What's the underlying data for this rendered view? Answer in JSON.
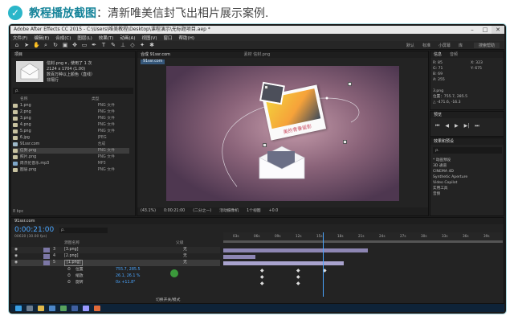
{
  "header": {
    "title": "教程播放截图",
    "subtitle": "：清新唯美信封飞出相片展示案例.",
    "check_icon": "check-icon"
  },
  "app": {
    "window_title": "Adobe After Effects CC 2015 - C:\\Users\\唯美教程\\Desktop\\课程演示\\无标题项目.aep *",
    "menu": [
      "文件(F)",
      "编辑(E)",
      "合成(C)",
      "图层(L)",
      "效果(T)",
      "动画(A)",
      "视图(V)",
      "窗口",
      "帮助(H)"
    ],
    "workspace_items": [
      "默认",
      "标准",
      "小屏幕",
      "库"
    ],
    "search_placeholder": "搜索帮助"
  },
  "project": {
    "tab": "项目",
    "selected_file": "信封.png",
    "used_info": "▾ , 使用了 1 次",
    "dimensions": "2124 x 1704 (1.00)",
    "color_info": "数百万种以上颜色（直线）",
    "interpret": "非隔行",
    "search_placeholder": "ρ.",
    "col_name": "名称",
    "col_type": "类型",
    "items": [
      {
        "name": "1.png",
        "type": "PNG 文件"
      },
      {
        "name": "2.png",
        "type": "PNG 文件"
      },
      {
        "name": "3.png",
        "type": "PNG 文件"
      },
      {
        "name": "4.png",
        "type": "PNG 文件"
      },
      {
        "name": "5.png",
        "type": "PNG 文件"
      },
      {
        "name": "6.jpg",
        "type": "JPEG"
      },
      {
        "name": "91ssr.com",
        "type": "合成"
      },
      {
        "name": "信封.png",
        "type": "PNG 文件"
      },
      {
        "name": "照片.png",
        "type": "PNG 文件"
      },
      {
        "name": "周杰伦音乐.mp3",
        "type": "MP3"
      },
      {
        "name": "图层.png",
        "type": "PNG 文件"
      }
    ],
    "footer": "8 bpc"
  },
  "viewer": {
    "tab": "合成 91ssr.com",
    "layer_tab": "素材 信封.png",
    "comp_label": "91ssr.com",
    "photo_caption": "美的青春留影",
    "zoom": "(43.1%)",
    "timecode": "0:00:21:00",
    "quality": "(二分之一)",
    "camera": "活动摄像机",
    "views": "1个视图",
    "exposure": "+0.0"
  },
  "info": {
    "tab_info": "信息",
    "tab_audio": "音频",
    "r": "R: 85",
    "g": "G: 71",
    "b": "B: 69",
    "a": "A: 255",
    "x": "X: 323",
    "y": "Y: 675",
    "file": "3.png",
    "pos1": "位置：755.7, 285.5",
    "pos2": "△ -471.6, -16.3"
  },
  "preview": {
    "tab": "预览"
  },
  "effects": {
    "tab": "效果和预设",
    "search_placeholder": "ρ.",
    "items": [
      "* 动画预设",
      "3D 通道",
      "CINEMA 4D",
      "Synthetic Aperture",
      "Video Copilot",
      "实用工具",
      "音频"
    ]
  },
  "timeline": {
    "comp_tab": "91ssr.com",
    "timecode": "0:00:21:00",
    "timecode_sub": "00630 (30.00 fps)",
    "col_layer_name": "源图名称",
    "col_parent": "父级",
    "layers": [
      {
        "index": "3",
        "name": "[3.png]",
        "parent": "无"
      },
      {
        "index": "4",
        "name": "[2.png]",
        "parent": "无"
      },
      {
        "index": "5",
        "name": "[1.png]",
        "parent": "无"
      }
    ],
    "props": [
      {
        "name": "位置",
        "value": "755.7, 285.5"
      },
      {
        "name": "缩放",
        "value": "26.1, 26.1 %"
      },
      {
        "name": "旋转",
        "value": "0x +11.8°"
      }
    ],
    "switch_label": "切换开关/模式",
    "ruler": [
      "03s",
      "06s",
      "09s",
      "12s",
      "15s",
      "18s",
      "21s",
      "24s",
      "27s",
      "30s",
      "33s",
      "36s",
      "39s"
    ]
  },
  "colors": {
    "accent": "#2bb6c9",
    "timeline_bar": "#8d86b3",
    "playhead": "#4aa6ff"
  }
}
